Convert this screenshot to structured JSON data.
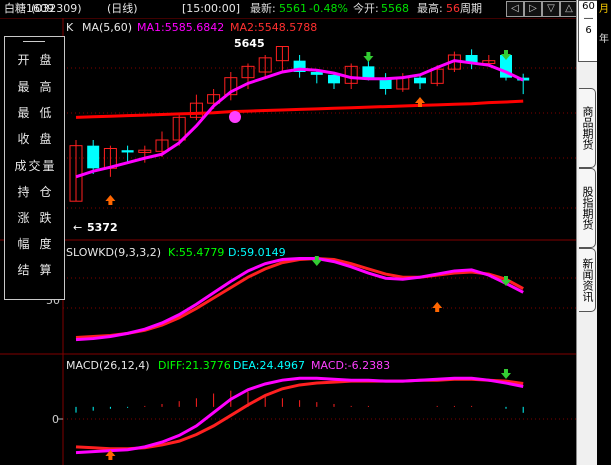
{
  "header": {
    "symbol": "白糖1609",
    "code": "(032309)",
    "period": "(日线)",
    "time": "[15:00:00]",
    "latest_label": "最新:",
    "latest_value": "5561",
    "change_pct": "-0.48%",
    "open_label": "今开:",
    "open_value": "5568",
    "high_label": "最高:",
    "high_value": "56",
    "cycle_label": "周期",
    "nav_buttons": [
      "◁",
      "▷",
      "▽",
      "△"
    ]
  },
  "menu": {
    "items": [
      "开盘",
      "最高",
      "最低",
      "收盘",
      "成交量",
      "持仓",
      "涨跌",
      "幅度",
      "结算"
    ]
  },
  "main_panel": {
    "indicator": "K",
    "ma_label": "MA(5,60)",
    "ma1": "MA1:5585.6842",
    "ma2": "MA2:5548.5788",
    "high_mark": "5645",
    "low_mark": "5372",
    "arrow_glyph": "←"
  },
  "kd_panel": {
    "title": "SLOWKD(9,3,3,2)",
    "k": "K:55.4779",
    "d": "D:59.0149",
    "axis_tick": "50"
  },
  "macd_panel": {
    "title": "MACD(26,12,4)",
    "diff": "DIFF:21.3776",
    "dea": "DEA:24.4967",
    "macd": "MACD:-6.2383",
    "zero_tick": "0"
  },
  "right_tabs": {
    "top": "60\n—\n6",
    "tabs": [
      "商品期货",
      "股指期货",
      "新闻资讯"
    ],
    "dark_chars": [
      "月",
      "年",
      "月"
    ]
  },
  "colors": {
    "up": "#ff2020",
    "down": "#00ffff",
    "ma1": "#ff00ff",
    "ma2": "#ff0000",
    "green": "#00ff00",
    "grid": "#800000"
  },
  "chart_data": [
    {
      "type": "candlestick",
      "name": "K",
      "candles": [
        {
          "o": 5372,
          "c": 5470,
          "h": 5480,
          "l": 5372
        },
        {
          "o": 5470,
          "c": 5430,
          "h": 5480,
          "l": 5420
        },
        {
          "o": 5430,
          "c": 5465,
          "h": 5470,
          "l": 5415
        },
        {
          "o": 5462,
          "c": 5458,
          "h": 5470,
          "l": 5440
        },
        {
          "o": 5458,
          "c": 5462,
          "h": 5470,
          "l": 5440
        },
        {
          "o": 5460,
          "c": 5480,
          "h": 5495,
          "l": 5450
        },
        {
          "o": 5480,
          "c": 5520,
          "h": 5525,
          "l": 5470
        },
        {
          "o": 5520,
          "c": 5545,
          "h": 5560,
          "l": 5515
        },
        {
          "o": 5545,
          "c": 5560,
          "h": 5570,
          "l": 5535
        },
        {
          "o": 5560,
          "c": 5590,
          "h": 5600,
          "l": 5550
        },
        {
          "o": 5590,
          "c": 5610,
          "h": 5615,
          "l": 5570
        },
        {
          "o": 5600,
          "c": 5625,
          "h": 5630,
          "l": 5590
        },
        {
          "o": 5620,
          "c": 5645,
          "h": 5645,
          "l": 5600
        },
        {
          "o": 5620,
          "c": 5600,
          "h": 5630,
          "l": 5590
        },
        {
          "o": 5600,
          "c": 5595,
          "h": 5605,
          "l": 5580
        },
        {
          "o": 5595,
          "c": 5580,
          "h": 5600,
          "l": 5570
        },
        {
          "o": 5580,
          "c": 5610,
          "h": 5615,
          "l": 5570
        },
        {
          "o": 5610,
          "c": 5590,
          "h": 5620,
          "l": 5585
        },
        {
          "o": 5590,
          "c": 5570,
          "h": 5598,
          "l": 5560
        },
        {
          "o": 5570,
          "c": 5590,
          "h": 5598,
          "l": 5565
        },
        {
          "o": 5590,
          "c": 5580,
          "h": 5595,
          "l": 5570
        },
        {
          "o": 5580,
          "c": 5605,
          "h": 5612,
          "l": 5575
        },
        {
          "o": 5605,
          "c": 5630,
          "h": 5636,
          "l": 5600
        },
        {
          "o": 5630,
          "c": 5615,
          "h": 5640,
          "l": 5605
        },
        {
          "o": 5615,
          "c": 5620,
          "h": 5630,
          "l": 5610
        },
        {
          "o": 5630,
          "c": 5590,
          "h": 5636,
          "l": 5585
        },
        {
          "o": 5590,
          "c": 5585,
          "h": 5597,
          "l": 5561
        }
      ],
      "ma1": [
        5415,
        5425,
        5432,
        5440,
        5448,
        5455,
        5475,
        5505,
        5540,
        5565,
        5580,
        5590,
        5600,
        5605,
        5603,
        5598,
        5590,
        5588,
        5588,
        5590,
        5595,
        5608,
        5620,
        5616,
        5612,
        5600,
        5585.6842
      ],
      "ma2": [
        5520,
        5521,
        5522,
        5523,
        5524,
        5525,
        5526,
        5527,
        5528,
        5530,
        5531,
        5532,
        5533,
        5534,
        5535,
        5536,
        5537,
        5538,
        5539,
        5540,
        5541,
        5542,
        5543,
        5544,
        5546,
        5547,
        5548.5788
      ],
      "ylim": [
        5360,
        5660
      ]
    },
    {
      "type": "line",
      "name": "SLOWKD(9,3,3,2)",
      "series": [
        {
          "name": "K",
          "values": [
            10,
            11,
            13,
            16,
            20,
            26,
            34,
            44,
            55,
            66,
            76,
            83,
            87,
            88,
            88,
            85,
            80,
            74,
            69,
            68,
            70,
            73,
            76,
            77,
            72,
            64,
            55.4779
          ]
        },
        {
          "name": "D",
          "values": [
            12,
            13,
            14,
            16,
            19,
            24,
            31,
            40,
            50,
            60,
            70,
            78,
            84,
            87,
            88,
            87,
            83,
            78,
            73,
            70,
            70,
            72,
            74,
            75,
            73,
            68,
            59.0149
          ]
        }
      ],
      "ylim": [
        0,
        100
      ]
    },
    {
      "type": "line",
      "name": "MACD(26,12,4)",
      "series": [
        {
          "name": "DIFF",
          "values": [
            -48,
            -47,
            -46,
            -45,
            -42,
            -37,
            -30,
            -20,
            -6,
            8,
            18,
            24,
            28,
            30,
            30,
            29,
            28,
            28,
            27,
            27,
            28,
            29,
            30,
            30,
            28,
            25,
            21.3776
          ]
        },
        {
          "name": "DEA",
          "values": [
            -42,
            -43,
            -44,
            -44,
            -43,
            -40,
            -36,
            -29,
            -20,
            -9,
            2,
            12,
            19,
            23,
            25,
            26,
            27,
            27,
            27,
            27,
            28,
            28,
            29,
            29,
            28,
            27,
            24.4967
          ]
        }
      ],
      "bars": [
        -6,
        -4,
        -2,
        -1,
        1,
        3,
        6,
        9,
        14,
        17,
        16,
        12,
        9,
        7,
        5,
        3,
        1,
        1,
        0,
        0,
        0,
        1,
        1,
        1,
        0,
        -2,
        -6.2383
      ],
      "ylim": [
        -60,
        45
      ]
    }
  ]
}
